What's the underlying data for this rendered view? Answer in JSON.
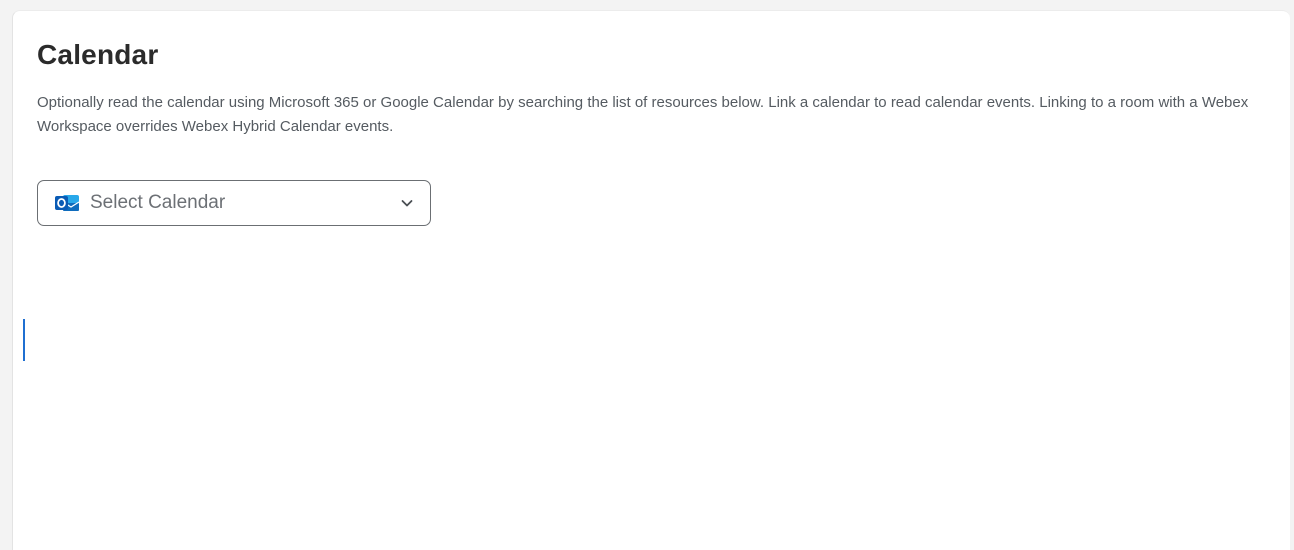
{
  "section": {
    "title": "Calendar",
    "description": "Optionally read the calendar using Microsoft 365 or Google Calendar by searching the list of resources below. Link a calendar to read calendar events. Linking to a room with a Webex Workspace overrides Webex Hybrid Calendar events."
  },
  "calendar_select": {
    "placeholder": "Select Calendar",
    "icon": "outlook-icon",
    "dropdown_icon": "chevron-down-icon"
  },
  "colors": {
    "panel_background": "#ffffff",
    "page_background": "#f3f3f3",
    "title_text": "#2b2b2b",
    "body_text": "#555b61",
    "select_border": "#6b6f73",
    "outlook_blue": "#0f6cbd",
    "focus_accent": "#1f6fd1"
  }
}
